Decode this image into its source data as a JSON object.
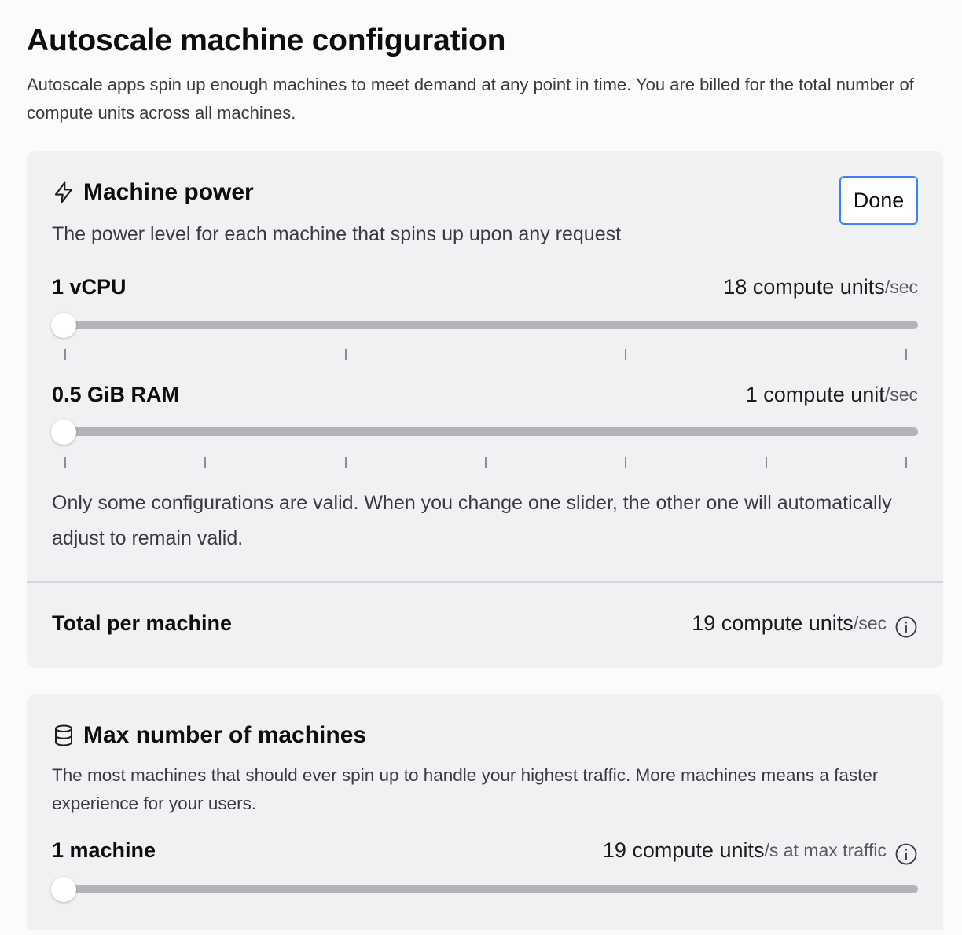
{
  "page": {
    "title": "Autoscale machine configuration",
    "description": "Autoscale apps spin up enough machines to meet demand at any point in time. You are billed for the total number of compute units across all machines."
  },
  "machine_power": {
    "icon": "lightning-icon",
    "title": "Machine power",
    "subtitle": "The power level for each machine that spins up upon any request",
    "done_label": "Done",
    "accent_color": "#3b82f6",
    "cpu": {
      "label": "1 vCPU",
      "value": "18 compute units",
      "unit": "/sec",
      "slider_position": 0,
      "tick_count": 4
    },
    "ram": {
      "label": "0.5 GiB RAM",
      "value": "1 compute unit",
      "unit": "/sec",
      "slider_position": 0,
      "tick_count": 7
    },
    "note": "Only some configurations are valid. When you change one slider, the other one will automatically adjust to remain valid.",
    "total": {
      "label": "Total per machine",
      "value": "19 compute units",
      "unit": "/sec",
      "icon": "info-icon"
    }
  },
  "max_machines": {
    "icon": "database-icon",
    "title": "Max number of machines",
    "subtitle": "The most machines that should ever spin up to handle your highest traffic. More machines means a faster experience for your users.",
    "machines": {
      "label": "1 machine",
      "value": "19 compute units",
      "unit": "/s at max traffic",
      "icon": "info-icon",
      "slider_position": 0
    }
  }
}
